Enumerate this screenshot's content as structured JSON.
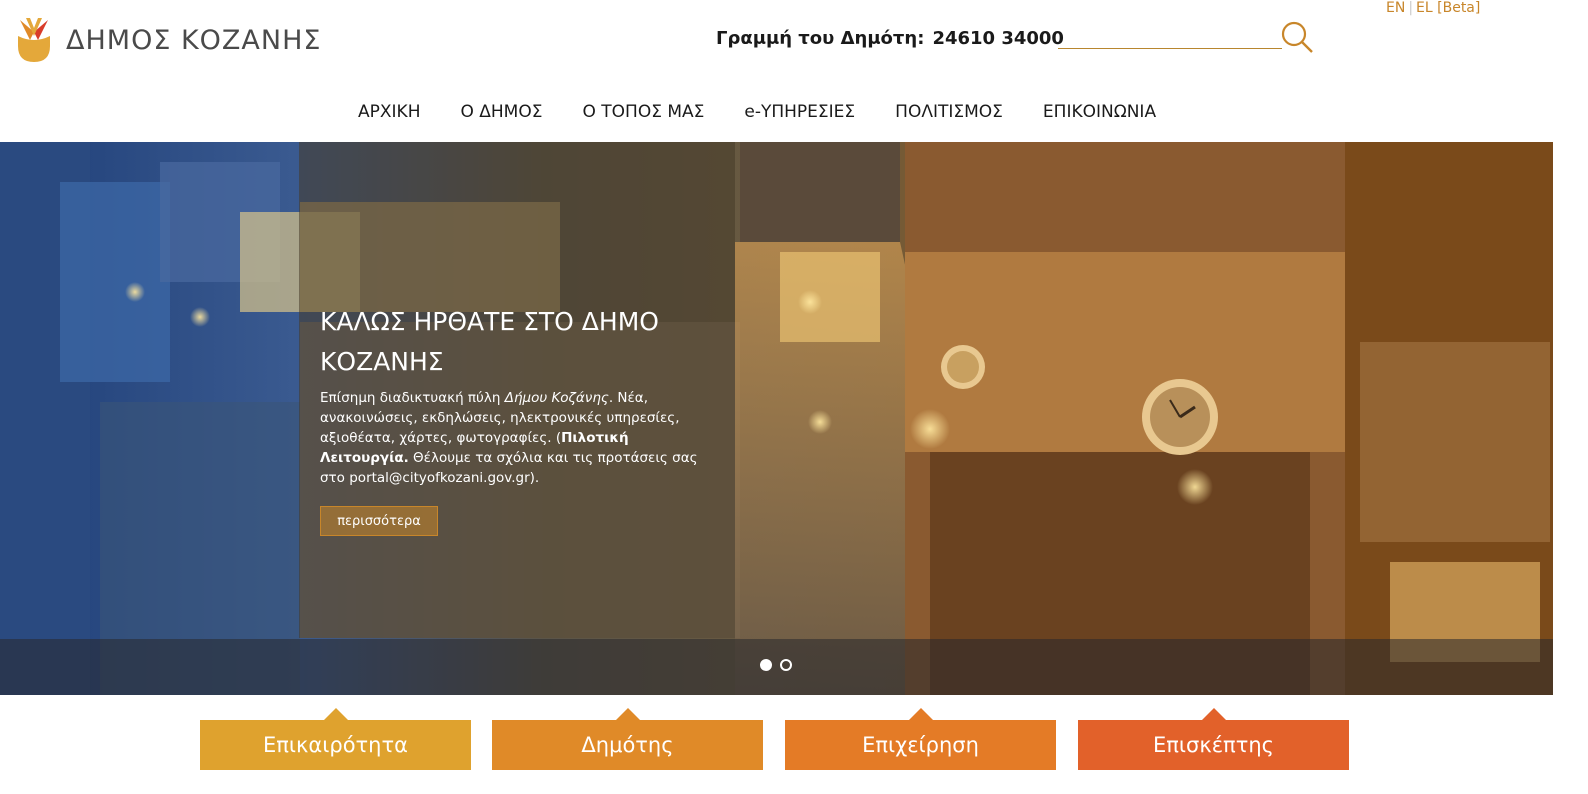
{
  "header": {
    "logo_text": "ΔΗΜΟΣ ΚΟΖΑΝΗΣ",
    "hotline_label": "Γραμμή του Δημότη:",
    "hotline_number": "24610 34000",
    "search_placeholder": "",
    "search_icon": "search-icon",
    "lang": {
      "en": "EN",
      "el": "EL [Beta]"
    }
  },
  "nav": [
    "ΑΡΧΙΚΗ",
    "Ο ΔΗΜΟΣ",
    "Ο ΤΟΠΟΣ ΜΑΣ",
    "e-ΥΠΗΡΕΣΙΕΣ",
    "ΠΟΛΙΤΙΣΜΟΣ",
    "ΕΠΙΚΟΙΝΩΝΙΑ"
  ],
  "hero": {
    "title": "ΚΑΛΩΣ ΗΡΘΑΤΕ ΣΤΟ ΔΗΜΟ ΚΟΖΑΝΗΣ",
    "desc_1": "Επίσημη διαδικτυακή πύλη ",
    "desc_2": "Δήμου Κοζάνης",
    "desc_3": ". Νέα, ανακοινώσεις, εκδηλώσεις, ηλεκτρονικές υπηρεσίες, αξιοθέατα, χάρτες, φωτογραφίες. (",
    "desc_4": "Πιλοτική Λειτουργία.",
    "desc_5": " Θέλουμε τα σχόλια και τις προτάσεις σας στο portal@cityofkozani.gov.gr).",
    "more_label": "περισσότερα",
    "slide_count": 2,
    "active_slide": 1
  },
  "tiles": [
    {
      "label": "Επικαιρότητα",
      "color": "#dfa22e"
    },
    {
      "label": "Δημότης",
      "color": "#e08a28"
    },
    {
      "label": "Επιχείρηση",
      "color": "#e47b26"
    },
    {
      "label": "Επισκέπτης",
      "color": "#e2612a"
    }
  ],
  "colors": {
    "accent": "#c8862a",
    "text": "#1a1a1a"
  }
}
